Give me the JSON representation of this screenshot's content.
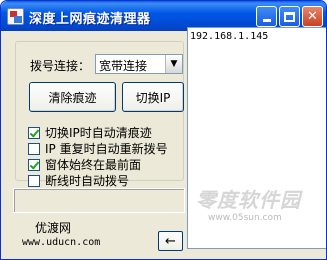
{
  "window": {
    "title": "深度上网痕迹清理器",
    "controls": {
      "minimize": "minimize",
      "maximize": "maximize",
      "close": "✕"
    }
  },
  "dial": {
    "label": "拨号连接：",
    "selected": "宽带连接",
    "arrow": "▼"
  },
  "buttons": {
    "clear": "清除痕迹",
    "switch_ip": "切换IP",
    "back": "←"
  },
  "options": [
    {
      "label": "切换IP时自动清痕迹",
      "checked": true
    },
    {
      "label": "IP 重复时自动重新拨号",
      "checked": false
    },
    {
      "label": "窗体始终在最前面",
      "checked": true
    },
    {
      "label": "断线时自动拨号",
      "checked": false
    }
  ],
  "status_text": "",
  "sponsor": {
    "name": "优渡网",
    "url": "www.uducn.com"
  },
  "ip_list": [
    "192.168.1.145"
  ],
  "watermark": {
    "main": "零度软件园",
    "sub": "www.05sun.com"
  }
}
